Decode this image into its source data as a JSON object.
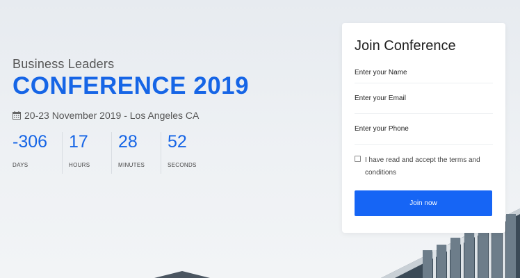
{
  "hero": {
    "subtitle": "Business Leaders",
    "title": "CONFERENCE 2019",
    "date_location": "20-23 November 2019 - Los Angeles CA",
    "date_icon": "calendar-icon"
  },
  "countdown": [
    {
      "value": "-306",
      "label": "DAYS"
    },
    {
      "value": "17",
      "label": "HOURS"
    },
    {
      "value": "28",
      "label": "MINUTES"
    },
    {
      "value": "52",
      "label": "SECONDS"
    }
  ],
  "form": {
    "title": "Join Conference",
    "name_placeholder": "Enter your Name",
    "email_placeholder": "Enter your Email",
    "phone_placeholder": "Enter your Phone",
    "terms_text": "I have read and accept the terms and conditions",
    "submit_label": "Join now"
  },
  "colors": {
    "accent": "#1665e6",
    "button": "#1665f5",
    "card": "#ffffff"
  }
}
